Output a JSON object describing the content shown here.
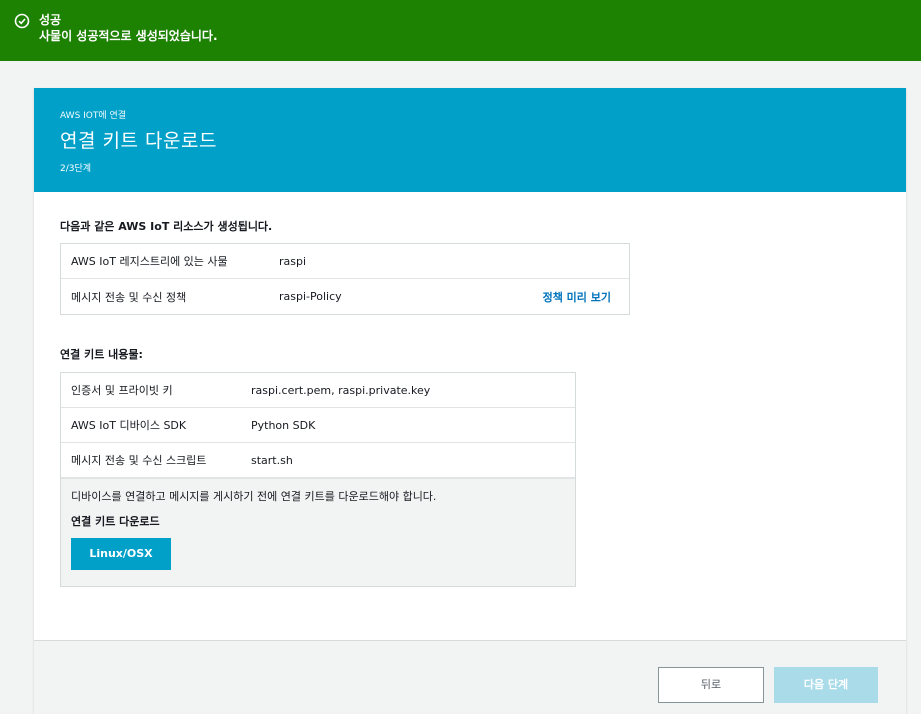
{
  "flash": {
    "title": "성공",
    "message": "사물이 성공적으로 생성되었습니다.",
    "color": "#1d8102"
  },
  "banner": {
    "breadcrumb": "AWS IOT에 연결",
    "title": "연결 키트 다운로드",
    "step": "2/3단계",
    "color": "#00a0c9"
  },
  "resources": {
    "title": "다음과 같은 AWS IoT 리소스가 생성됩니다.",
    "rows": [
      {
        "key": "AWS IoT 레지스트리에 있는 사물",
        "value": "raspi",
        "link": ""
      },
      {
        "key": "메시지 전송 및 수신 정책",
        "value": "raspi-Policy",
        "link": "정책 미리 보기"
      }
    ]
  },
  "kit": {
    "title": "연결 키트 내용물:",
    "rows": [
      {
        "key": "인증서 및 프라이빗 키",
        "value": "raspi.cert.pem, raspi.private.key"
      },
      {
        "key": "AWS IoT 디바이스 SDK",
        "value": "Python SDK"
      },
      {
        "key": "메시지 전송 및 수신 스크립트",
        "value": "start.sh"
      }
    ],
    "note": "디바이스를 연결하고 메시지를 게시하기 전에 연결 키트를 다운로드해야 합니다.",
    "download_title": "연결 키트 다운로드",
    "download_button": "Linux/OSX"
  },
  "footer": {
    "back_label": "뒤로",
    "next_label": "다음 단계"
  }
}
